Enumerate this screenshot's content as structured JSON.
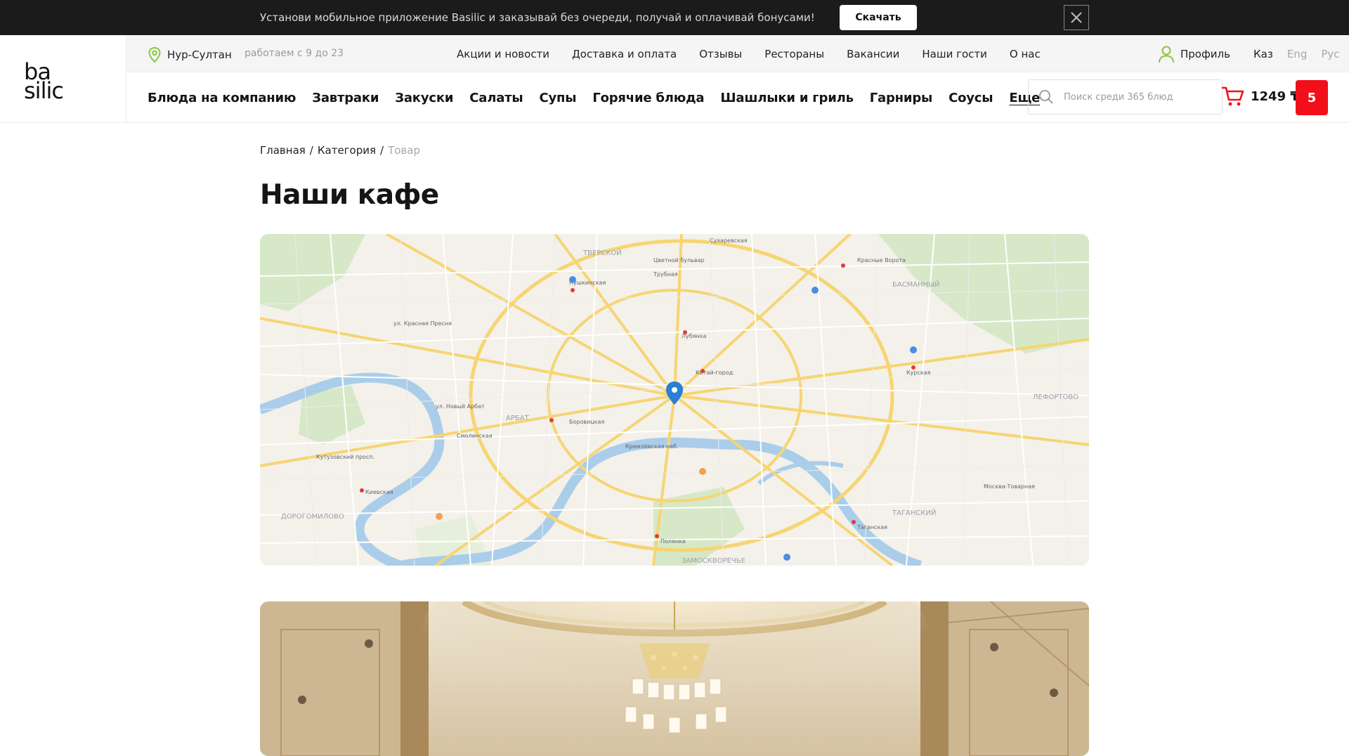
{
  "promo": {
    "text": "Установи мобильное приложение Basilic и заказывай без очереди, получай и оплачивай бонусами!",
    "button_label": "Скачать"
  },
  "logo": {
    "line1": "ba",
    "line2": "silic"
  },
  "topbar": {
    "city": "Нур-Султан",
    "hours": "работаем с 9 до 23",
    "nav": [
      "Акции и новости",
      "Доставка и оплата",
      "Отзывы",
      "Рестораны",
      "Вакансии",
      "Наши гости",
      "О нас"
    ],
    "profile_label": "Профиль",
    "languages": [
      "Каз",
      "Eng",
      "Рус"
    ]
  },
  "categories": [
    "Блюда на компанию",
    "Завтраки",
    "Закуски",
    "Салаты",
    "Супы",
    "Горячие блюда",
    "Шашлыки и гриль",
    "Гарниры",
    "Соусы",
    "Еще"
  ],
  "search": {
    "placeholder": "Поиск среди 365 блюд"
  },
  "cart": {
    "total": "1249 ₸",
    "count": "5"
  },
  "breadcrumbs": [
    "Главная",
    "Категория",
    "Товар"
  ],
  "page_title": "Наши кафе",
  "map": {
    "districts": [
      "ТВЕРСКОЙ",
      "БАСМАННЫЙ",
      "АРБАТ",
      "ДОРОГОМИЛОВО",
      "ТАГАНСКИЙ",
      "ЗАМОСКВОРЕЧЬЕ",
      "ЛЕФОРТОВО"
    ],
    "streets": [
      "ул. Новый Арбат",
      "ул. Красная Пресня",
      "Кутузовский просп.",
      "Пушкинская",
      "Лубянка",
      "Китай-город",
      "Кремлёвская наб.",
      "Таганская",
      "Курская",
      "Москва-Товарная",
      "Боровицкая",
      "Полянка",
      "Киевская",
      "Смоленская",
      "Красные Ворота",
      "Сухаревская",
      "Цветной бульвар",
      "Трубная"
    ],
    "colors": {
      "water": "#a9cdea",
      "major_road": "#f6d572",
      "road": "#ffffff",
      "park": "#cfe5c0",
      "marker": "#2b7fd6"
    }
  },
  "colors": {
    "accent_red": "#f1101a",
    "location_green": "#8cc63f",
    "banner_bg": "#1b1b1b"
  }
}
